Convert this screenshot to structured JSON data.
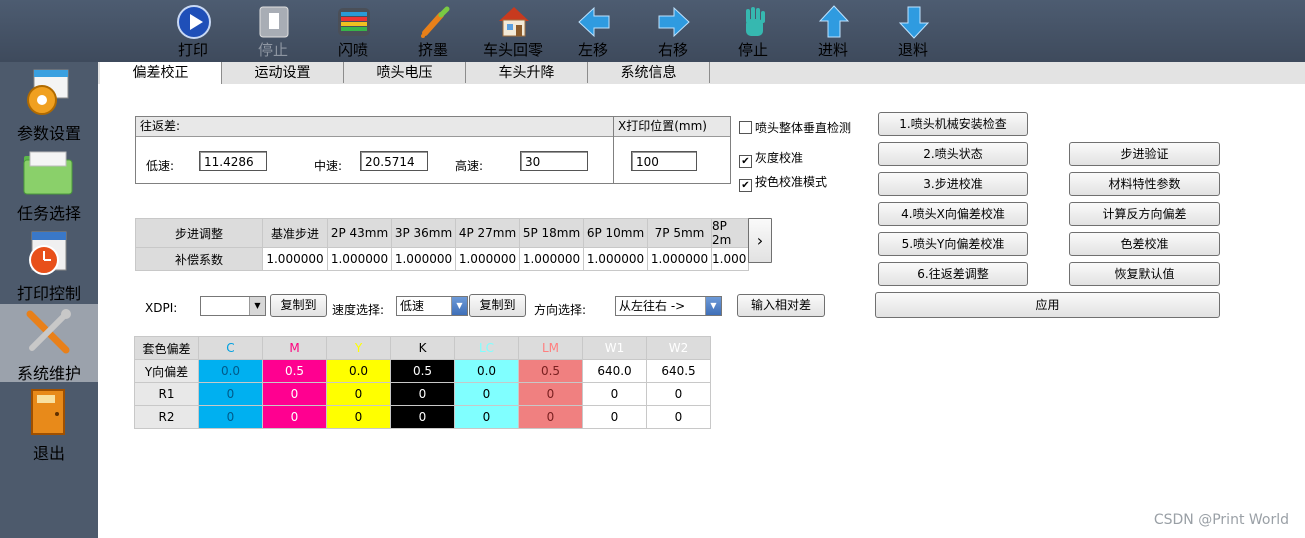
{
  "toolbar": {
    "items": [
      {
        "label": "打印",
        "icon": "play-icon"
      },
      {
        "label": "停止",
        "icon": "pause-icon"
      },
      {
        "label": "闪喷",
        "icon": "flash-spray-icon"
      },
      {
        "label": "挤墨",
        "icon": "ink-dropper-icon"
      },
      {
        "label": "车头回零",
        "icon": "home-icon"
      },
      {
        "label": "左移",
        "icon": "arrow-left-icon"
      },
      {
        "label": "右移",
        "icon": "arrow-right-icon"
      },
      {
        "label": "停止",
        "icon": "hand-stop-icon"
      },
      {
        "label": "进料",
        "icon": "arrow-up-icon"
      },
      {
        "label": "退料",
        "icon": "arrow-down-icon"
      }
    ]
  },
  "sidebar": {
    "items": [
      {
        "label": "参数设置",
        "icon": "gear-settings-icon"
      },
      {
        "label": "任务选择",
        "icon": "folder-icon"
      },
      {
        "label": "打印控制",
        "icon": "clock-icon"
      },
      {
        "label": "系统维护",
        "icon": "tools-icon"
      },
      {
        "label": "退出",
        "icon": "exit-door-icon"
      }
    ]
  },
  "tabs": [
    "偏差校正",
    "运动设置",
    "喷头电压",
    "车头升降",
    "系统信息"
  ],
  "bidir": {
    "title": "往返差:",
    "low_label": "低速:",
    "low_value": "11.4286",
    "mid_label": "中速:",
    "mid_value": "20.5714",
    "high_label": "高速:",
    "high_value": "30"
  },
  "xpos": {
    "title": "X打印位置(mm)",
    "value": "100"
  },
  "checks": [
    {
      "label": "喷头整体垂直检测",
      "checked": false
    },
    {
      "label": "灰度校准",
      "checked": true
    },
    {
      "label": "按色校准模式",
      "checked": true
    }
  ],
  "buttons_left": [
    "1.喷头机械安装检查",
    "2.喷头状态",
    "3.步进校准",
    "4.喷头X向偏差校准",
    "5.喷头Y向偏差校准",
    "6.往返差调整"
  ],
  "buttons_right": [
    "步进验证",
    "材料特性参数",
    "计算反方向偏差",
    "色差校准",
    "恢复默认值"
  ],
  "apply_label": "应用",
  "step_table": {
    "headers": [
      "步进调整",
      "基准步进",
      "2P 43mm",
      "3P 36mm",
      "4P 27mm",
      "5P 18mm",
      "6P 10mm",
      "7P 5mm",
      "8P 2m"
    ],
    "row": [
      "补偿系数",
      "1.000000",
      "1.000000",
      "1.000000",
      "1.000000",
      "1.000000",
      "1.000000",
      "1.000000",
      "1.000"
    ],
    "scroll_icon": "›"
  },
  "controls": {
    "xdpi_label": "XDPI:",
    "xdpi_value": "",
    "copy_label": "复制到",
    "speed_label": "速度选择:",
    "speed_value": "低速",
    "direction_label": "方向选择:",
    "direction_value": "从左往右 ->",
    "input_rel_label": "输入相对差"
  },
  "color_table": {
    "headers": [
      "套色偏差",
      "C",
      "M",
      "Y",
      "K",
      "LC",
      "LM",
      "W1",
      "W2"
    ],
    "header_colors": [
      "#000000",
      "#00a0e0",
      "#ff007f",
      "#ffff00",
      "#000000",
      "#80ffff",
      "#ff7f7f",
      "#ffffff",
      "#ffffff"
    ],
    "rows": [
      [
        "Y向偏差",
        "0.0",
        "0.5",
        "0.0",
        "0.5",
        "0.0",
        "0.5",
        "640.0",
        "640.5"
      ],
      [
        "R1",
        "0",
        "0",
        "0",
        "0",
        "0",
        "0",
        "0",
        "0"
      ],
      [
        "R2",
        "0",
        "0",
        "0",
        "0",
        "0",
        "0",
        "0",
        "0"
      ]
    ],
    "cell_bg": [
      "#00b0f0",
      "#ff0090",
      "#ffff00",
      "#000000",
      "#80ffff",
      "#f08080",
      "#ffffff",
      "#ffffff"
    ],
    "cell_fg": [
      "#005a8a",
      "#ffffff",
      "#000000",
      "#ffffff",
      "#000000",
      "#7a2020",
      "#000000",
      "#000000"
    ]
  },
  "watermark": "CSDN @Print World"
}
